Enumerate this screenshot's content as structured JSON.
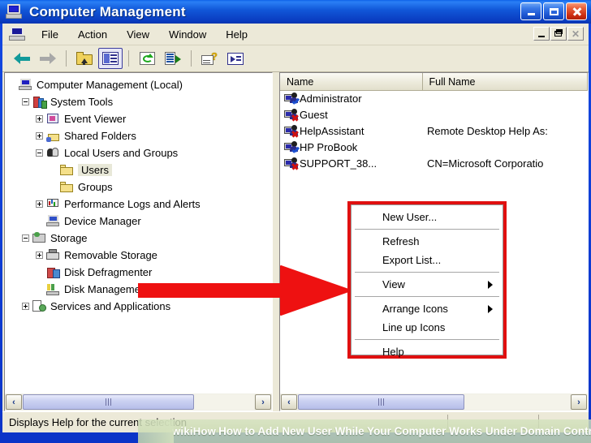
{
  "window": {
    "title": "Computer Management",
    "icon": "computer-icon",
    "buttons": {
      "minimize": "Minimize",
      "maximize": "Maximize",
      "close": "Close"
    },
    "mdi_buttons": {
      "minimize": "Minimize",
      "restore": "Restore",
      "close": "Close"
    }
  },
  "menubar": {
    "items": [
      {
        "label": "File"
      },
      {
        "label": "Action"
      },
      {
        "label": "View"
      },
      {
        "label": "Window"
      },
      {
        "label": "Help"
      }
    ]
  },
  "toolbar": {
    "items": [
      {
        "name": "back-button",
        "icon": "back-arrow-icon",
        "enabled": true
      },
      {
        "name": "forward-button",
        "icon": "forward-arrow-icon",
        "enabled": false
      },
      {
        "name": "up-one-level-button",
        "icon": "up-folder-icon",
        "enabled": true
      },
      {
        "name": "show-hide-console-tree-button",
        "icon": "two-pane-icon",
        "enabled": true,
        "pressed": true
      },
      {
        "name": "refresh-button",
        "icon": "refresh-icon",
        "enabled": true
      },
      {
        "name": "export-list-button",
        "icon": "export-list-icon",
        "enabled": true
      },
      {
        "name": "help-button",
        "icon": "help-page-icon",
        "enabled": true
      },
      {
        "name": "run-button",
        "icon": "run-icon",
        "enabled": true
      }
    ]
  },
  "tree": {
    "nodes": [
      {
        "label": "Computer Management (Local)",
        "indent": 0,
        "toggle": "none",
        "icon": "computer-icon",
        "selected": false
      },
      {
        "label": "System Tools",
        "indent": 1,
        "toggle": "minus",
        "icon": "system-tools-icon",
        "selected": false
      },
      {
        "label": "Event Viewer",
        "indent": 2,
        "toggle": "plus",
        "icon": "event-viewer-icon",
        "selected": false
      },
      {
        "label": "Shared Folders",
        "indent": 2,
        "toggle": "plus",
        "icon": "shared-folders-icon",
        "selected": false
      },
      {
        "label": "Local Users and Groups",
        "indent": 2,
        "toggle": "minus",
        "icon": "local-users-groups-icon",
        "selected": false
      },
      {
        "label": "Users",
        "indent": 3,
        "toggle": "none",
        "icon": "folder-icon",
        "selected": true
      },
      {
        "label": "Groups",
        "indent": 3,
        "toggle": "none",
        "icon": "folder-icon",
        "selected": false
      },
      {
        "label": "Performance Logs and Alerts",
        "indent": 2,
        "toggle": "plus",
        "icon": "performance-logs-icon",
        "selected": false
      },
      {
        "label": "Device Manager",
        "indent": 2,
        "toggle": "none",
        "icon": "device-manager-icon",
        "selected": false
      },
      {
        "label": "Storage",
        "indent": 1,
        "toggle": "minus",
        "icon": "storage-icon",
        "selected": false
      },
      {
        "label": "Removable Storage",
        "indent": 2,
        "toggle": "plus",
        "icon": "removable-storage-icon",
        "selected": false
      },
      {
        "label": "Disk Defragmenter",
        "indent": 2,
        "toggle": "none",
        "icon": "disk-defrag-icon",
        "selected": false
      },
      {
        "label": "Disk Management",
        "indent": 2,
        "toggle": "none",
        "icon": "disk-management-icon",
        "selected": false
      },
      {
        "label": "Services and Applications",
        "indent": 1,
        "toggle": "plus",
        "icon": "services-apps-icon",
        "selected": false
      }
    ]
  },
  "list": {
    "columns": [
      {
        "label": "Name"
      },
      {
        "label": "Full Name"
      }
    ],
    "rows": [
      {
        "name": "Administrator",
        "full_name": "",
        "icon": "user-enabled-icon"
      },
      {
        "name": "Guest",
        "full_name": "",
        "icon": "user-disabled-icon"
      },
      {
        "name": "HelpAssistant",
        "full_name": "Remote Desktop Help As:",
        "icon": "user-disabled-icon"
      },
      {
        "name": "HP ProBook",
        "full_name": "",
        "icon": "user-enabled-icon"
      },
      {
        "name": "SUPPORT_38...",
        "full_name": "CN=Microsoft Corporatio",
        "icon": "user-disabled-icon"
      }
    ]
  },
  "context_menu": {
    "items": [
      {
        "label": "New User...",
        "submenu": false,
        "divider_after": true
      },
      {
        "label": "Refresh",
        "submenu": false,
        "divider_after": false
      },
      {
        "label": "Export List...",
        "submenu": false,
        "divider_after": true
      },
      {
        "label": "View",
        "submenu": true,
        "divider_after": true
      },
      {
        "label": "Arrange Icons",
        "submenu": true,
        "divider_after": false
      },
      {
        "label": "Line up Icons",
        "submenu": false,
        "divider_after": true
      },
      {
        "label": "Help",
        "submenu": false,
        "divider_after": false
      }
    ]
  },
  "scrollbars": {
    "left_pane": {
      "left_arrow": "‹",
      "right_arrow": "›"
    },
    "right_pane": {
      "left_arrow": "‹",
      "right_arrow": "›"
    }
  },
  "statusbar": {
    "text": "Displays Help for the current selection"
  },
  "watermark": {
    "brand": "wikiHow",
    "text": "How to Add New User While Your Computer Works Under Domain Controller"
  },
  "annotations": {
    "arrow": "red-arrow-pointer",
    "highlight_box": "red-highlight-box"
  },
  "colors": {
    "title_blue": "#0f3fd8",
    "chrome": "#ece9d8",
    "accent_red": "#e01010",
    "selection": "#e8e8d8"
  }
}
